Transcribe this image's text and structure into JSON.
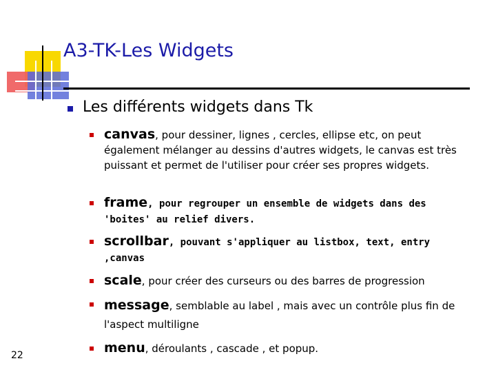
{
  "slide": {
    "title": "A3-TK-Les Widgets",
    "heading": "Les différents widgets dans Tk",
    "items": [
      {
        "keyword": "canvas",
        "text": ", pour dessiner, lignes , cercles, ellipse etc, on peut également mélanger au dessins d'autres widgets, le canvas est très puissant et permet de l'utiliser pour créer ses propres widgets."
      },
      {
        "keyword": "frame",
        "text": ", pour regrouper un ensemble de widgets dans des 'boites' au relief divers."
      },
      {
        "keyword": "scrollbar",
        "text": ", pouvant s'appliquer au listbox, text, entry ,canvas"
      },
      {
        "keyword": "scale",
        "text": ", pour créer des curseurs ou des barres de progression"
      },
      {
        "keyword": "message",
        "text": ", semblable au label , mais avec un contrôle plus fin de l'aspect multiligne"
      },
      {
        "keyword": "menu",
        "text": ", déroulants , cascade , et popup."
      }
    ],
    "page_number": "22"
  },
  "colors": {
    "title": "#1b1ba8",
    "bullet_level1": "#1b1ba8",
    "bullet_level2": "#cc0000",
    "deco_yellow": "#f8d800",
    "deco_red": "#ef5d5d",
    "deco_blue": "#5a6bd8"
  }
}
